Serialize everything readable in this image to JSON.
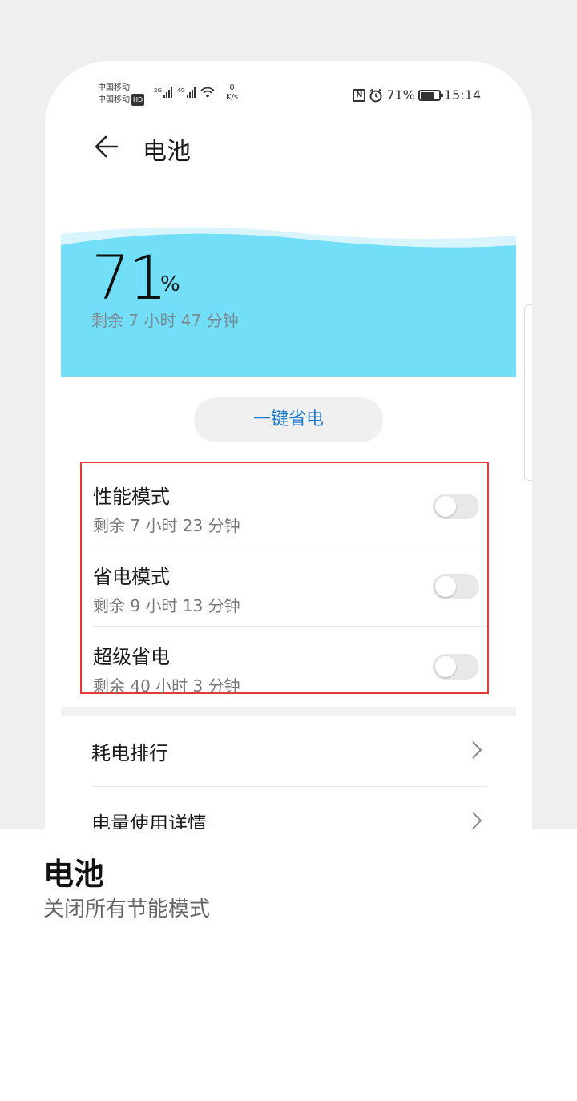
{
  "status_bar": {
    "carrier_1": "中国移动",
    "carrier_2": "中国移动",
    "hd_badge": "HD",
    "net_1": "2G",
    "net_2": "4G",
    "speed_value": "0",
    "speed_unit": "K/s",
    "nfc": "N",
    "battery": "71%",
    "time": "15:14"
  },
  "header": {
    "title": "电池"
  },
  "battery": {
    "percent": "71",
    "percent_sign": "%",
    "remaining": "剩余 7 小时 47 分钟",
    "level_fraction": 0.71
  },
  "saver_button": {
    "label": "一键省电"
  },
  "modes": [
    {
      "title": "性能模式",
      "subtitle": "剩余 7 小时 23 分钟",
      "enabled": false
    },
    {
      "title": "省电模式",
      "subtitle": "剩余 9 小时 13 分钟",
      "enabled": false
    },
    {
      "title": "超级省电",
      "subtitle": "剩余 40 小时 3 分钟",
      "enabled": false
    }
  ],
  "menu": [
    {
      "label": "耗电排行"
    },
    {
      "label": "电量使用详情"
    }
  ],
  "caption": {
    "title": "电池",
    "subtitle": "关闭所有节能模式"
  },
  "colors": {
    "water": "#72def8",
    "accent_blue": "#1f7acb",
    "highlight_red": "#e53935"
  }
}
